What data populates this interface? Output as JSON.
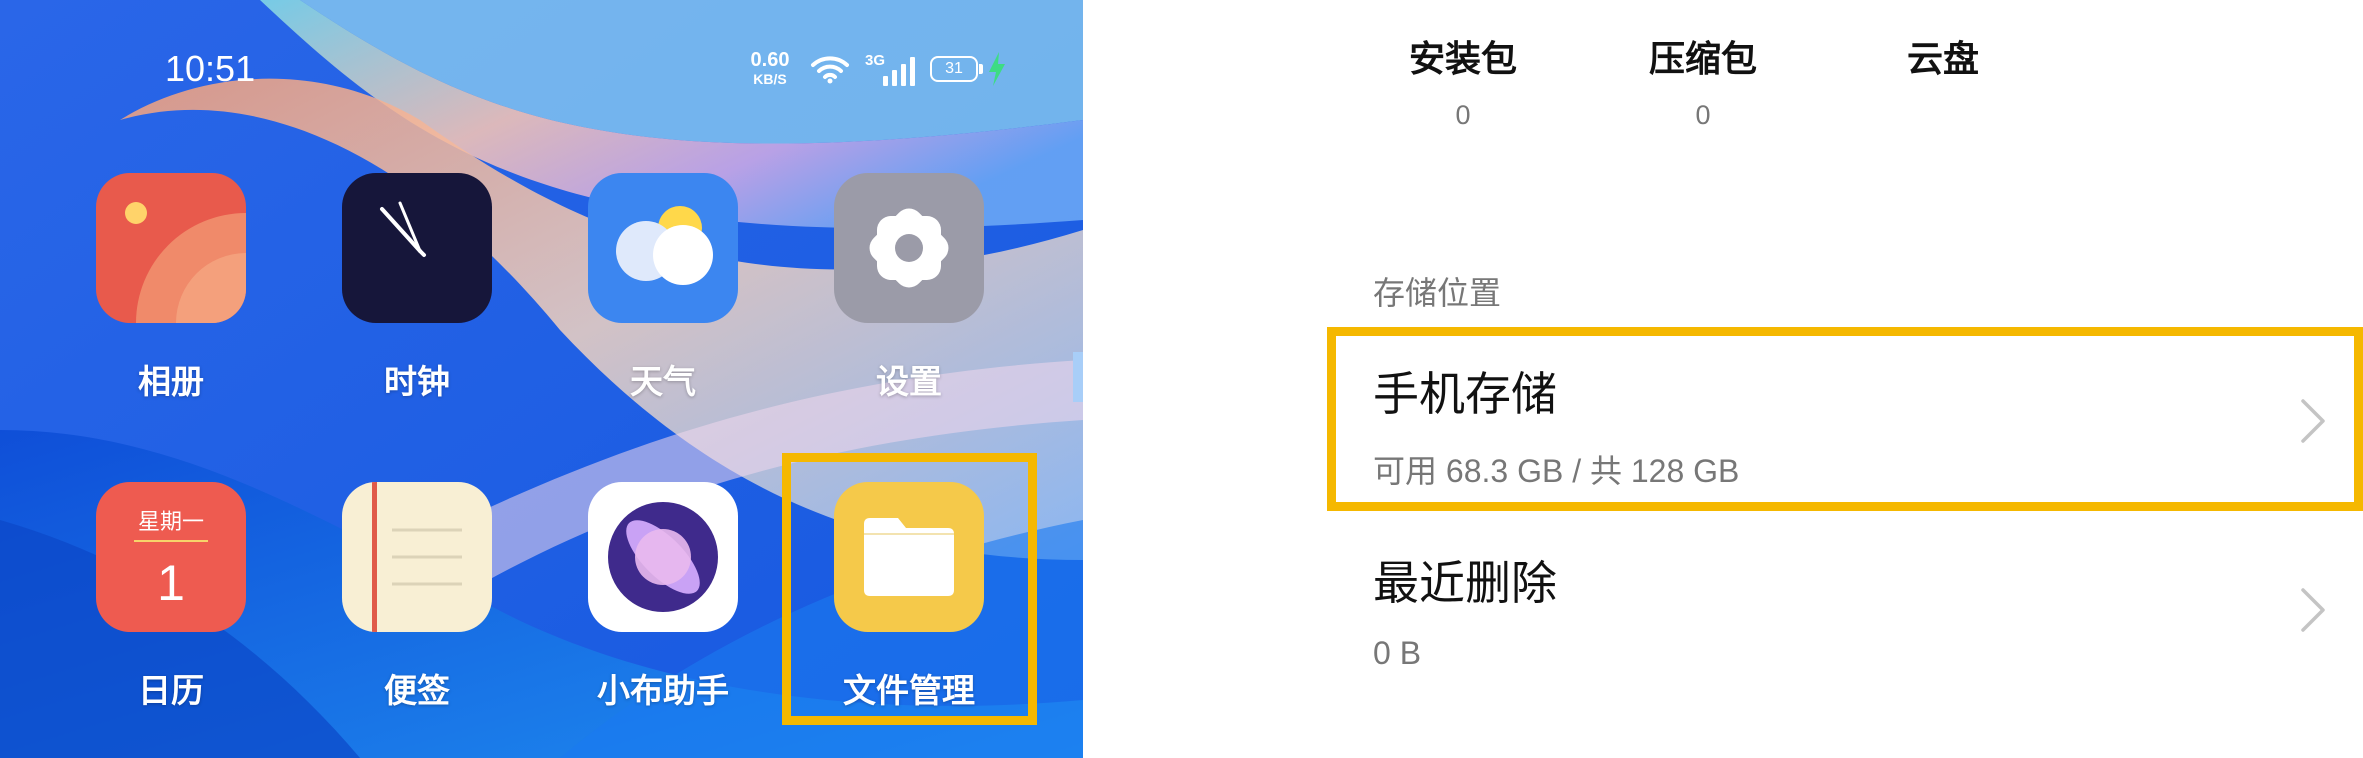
{
  "phone": {
    "status_bar": {
      "time": "10:51",
      "net_speed_value": "0.60",
      "net_speed_unit": "KB/S",
      "signal_type": "3G",
      "battery": "31"
    },
    "apps": [
      {
        "label": "相册",
        "icon": "photos-icon"
      },
      {
        "label": "时钟",
        "icon": "clock-icon"
      },
      {
        "label": "天气",
        "icon": "weather-icon"
      },
      {
        "label": "设置",
        "icon": "gear-icon"
      },
      {
        "label": "日历",
        "icon": "calendar-icon",
        "day": "星期一",
        "date": "1"
      },
      {
        "label": "便签",
        "icon": "notes-icon"
      },
      {
        "label": "小布助手",
        "icon": "assistant-icon"
      },
      {
        "label": "文件管理",
        "icon": "folder-icon"
      }
    ],
    "highlighted_app": "文件管理"
  },
  "files": {
    "categories": [
      {
        "name": "安装包",
        "count": "0"
      },
      {
        "name": "压缩包",
        "count": "0"
      },
      {
        "name": "云盘",
        "count": ""
      }
    ],
    "section_title": "存储位置",
    "storage": [
      {
        "title": "手机存储",
        "subtitle": "可用 68.3 GB / 共 128 GB",
        "highlighted": true
      },
      {
        "title": "最近删除",
        "subtitle": "0 B",
        "highlighted": false
      }
    ]
  },
  "colors": {
    "highlight": "#f5b800",
    "arrow": "#a8cef8",
    "wallpaper_blue": "#1f6ff0"
  }
}
